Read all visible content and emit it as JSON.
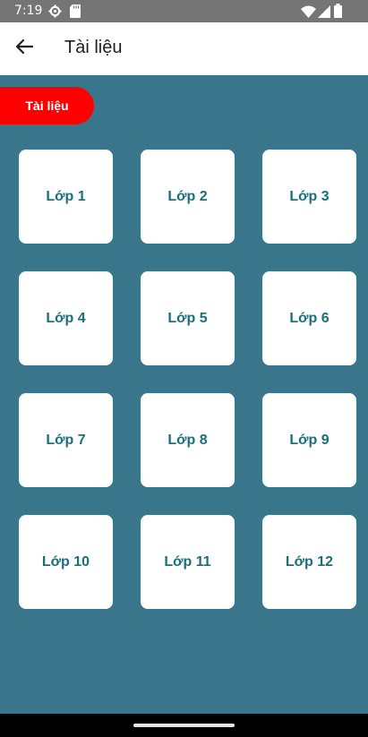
{
  "status_bar": {
    "time": "7:19",
    "icons": [
      "settings-icon",
      "sd-card-icon",
      "wifi-icon",
      "signal-icon",
      "battery-icon"
    ]
  },
  "app_bar": {
    "back_icon": "arrow-back-icon",
    "title": "Tài liệu"
  },
  "section": {
    "label": "Tài liệu",
    "color": "#ff0000"
  },
  "grades": [
    {
      "label": "Lớp 1"
    },
    {
      "label": "Lớp 2"
    },
    {
      "label": "Lớp 3"
    },
    {
      "label": "Lớp 4"
    },
    {
      "label": "Lớp 5"
    },
    {
      "label": "Lớp 6"
    },
    {
      "label": "Lớp 7"
    },
    {
      "label": "Lớp 8"
    },
    {
      "label": "Lớp 9"
    },
    {
      "label": "Lớp 10"
    },
    {
      "label": "Lớp 11"
    },
    {
      "label": "Lớp 12"
    }
  ],
  "colors": {
    "background": "#3a768b",
    "card": "#ffffff",
    "card_text": "#1a6f7a",
    "status_bar": "#757575"
  }
}
